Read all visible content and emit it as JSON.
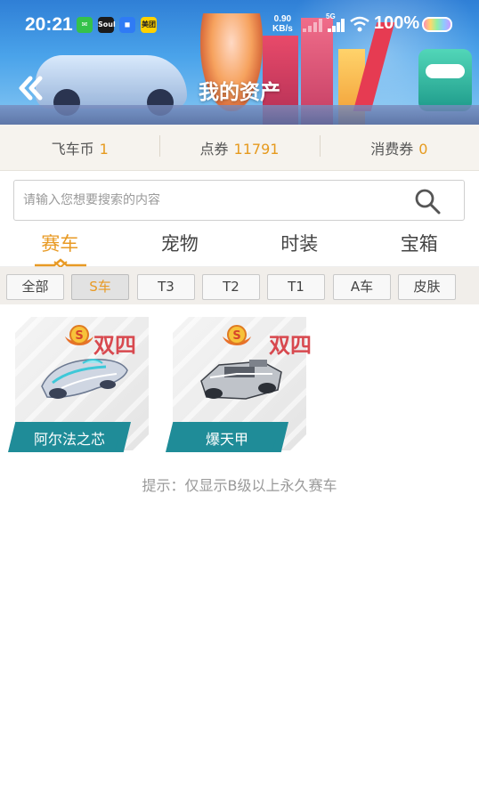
{
  "status_bar": {
    "time": "20:21",
    "net_speed": "0.90",
    "net_unit": "KB/s",
    "net_type": "5G",
    "battery": "100%",
    "app_icons": [
      "wechat-icon",
      "soul-icon",
      "blue-app-icon",
      "meituan-icon"
    ],
    "soul_label": "Soul",
    "meituan_label": "美团"
  },
  "header": {
    "title": "我的资产",
    "back_icon": "double-chevron-left-icon"
  },
  "currencies": [
    {
      "label": "飞车币",
      "value": "1"
    },
    {
      "label": "点券",
      "value": "11791"
    },
    {
      "label": "消费券",
      "value": "0"
    }
  ],
  "search": {
    "placeholder": "请输入您想要搜索的内容",
    "value": "",
    "icon": "search-icon"
  },
  "tabs": [
    {
      "label": "赛车",
      "active": true
    },
    {
      "label": "宠物",
      "active": false
    },
    {
      "label": "时装",
      "active": false
    },
    {
      "label": "宝箱",
      "active": false
    }
  ],
  "filters": [
    {
      "label": "全部",
      "active": false
    },
    {
      "label": "S车",
      "active": true
    },
    {
      "label": "T3",
      "active": false
    },
    {
      "label": "T2",
      "active": false
    },
    {
      "label": "T1",
      "active": false
    },
    {
      "label": "A车",
      "active": false
    },
    {
      "label": "皮肤",
      "active": false
    }
  ],
  "items": [
    {
      "name": "阿尔法之芯",
      "tag": "双四",
      "rank": "S"
    },
    {
      "name": "爆天甲",
      "tag": "双四",
      "rank": "S"
    }
  ],
  "hint": "提示：仅显示B级以上永久赛车",
  "colors": {
    "accent": "#e89a24",
    "tag_red": "#d8494f",
    "banner_teal": "#1f8c98"
  }
}
